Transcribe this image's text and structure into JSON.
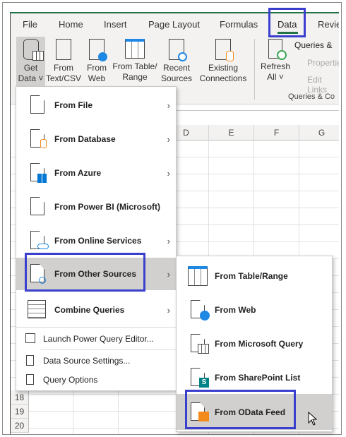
{
  "tabs": [
    "File",
    "Home",
    "Insert",
    "Page Layout",
    "Formulas",
    "Data",
    "Revie"
  ],
  "active_tab": "Data",
  "ribbon": {
    "get_data": [
      "Get",
      "Data ˅"
    ],
    "from_text": [
      "From",
      "Text/CSV"
    ],
    "from_web": [
      "From",
      "Web"
    ],
    "from_table": [
      "From Table/",
      "Range"
    ],
    "recent": [
      "Recent",
      "Sources"
    ],
    "existing": [
      "Existing",
      "Connections"
    ],
    "refresh": [
      "Refresh",
      "All ˅"
    ],
    "queries": "Queries &",
    "properties": "Properties",
    "edit_links": "Edit Links",
    "group_label": "Queries & Co"
  },
  "columns": [
    "D",
    "E",
    "F",
    "G"
  ],
  "rows": [
    "18",
    "19",
    "20"
  ],
  "menu": {
    "items": [
      "From File",
      "From Database",
      "From Azure",
      "From Power BI (Microsoft)",
      "From Online Services",
      "From Other Sources",
      "Combine Queries"
    ],
    "small_items": [
      "Launch Power Query Editor...",
      "Data Source Settings...",
      "Query Options"
    ]
  },
  "submenu": {
    "items": [
      "From Table/Range",
      "From Web",
      "From Microsoft Query",
      "From SharePoint List",
      "From OData Feed"
    ]
  },
  "colors": {
    "accent": "#217346",
    "highlight_box": "#3b3fce",
    "hover": "#d2d0ce",
    "odata": "#f38b1c",
    "sharepoint": "#038387",
    "globe": "#1e88e5"
  }
}
